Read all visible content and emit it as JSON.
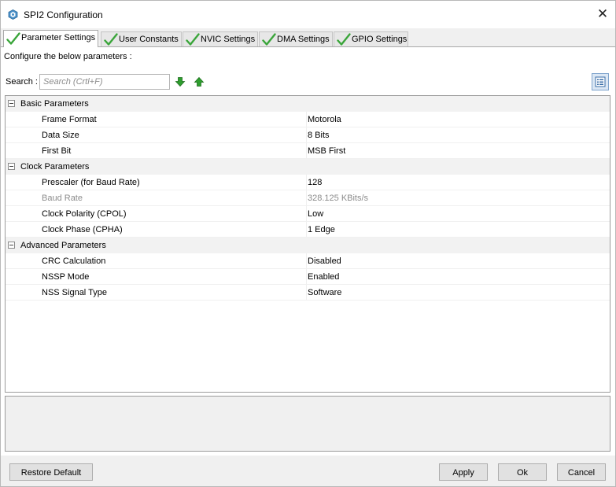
{
  "window": {
    "title": "SPI2 Configuration"
  },
  "tabs": [
    {
      "label": "Parameter Settings",
      "active": true
    },
    {
      "label": "User Constants",
      "active": false
    },
    {
      "label": "NVIC Settings",
      "active": false
    },
    {
      "label": "DMA Settings",
      "active": false
    },
    {
      "label": "GPIO Settings",
      "active": false
    }
  ],
  "instructions": "Configure the below parameters :",
  "search": {
    "label": "Search :",
    "placeholder": "Search (Crtl+F)"
  },
  "groups": [
    {
      "label": "Basic Parameters",
      "params": [
        {
          "name": "Frame Format",
          "value": "Motorola"
        },
        {
          "name": "Data Size",
          "value": "8 Bits"
        },
        {
          "name": "First Bit",
          "value": "MSB First"
        }
      ]
    },
    {
      "label": "Clock Parameters",
      "params": [
        {
          "name": "Prescaler (for Baud Rate)",
          "value": "128"
        },
        {
          "name": "Baud Rate",
          "value": "328.125 KBits/s",
          "readonly": true
        },
        {
          "name": "Clock Polarity (CPOL)",
          "value": "Low"
        },
        {
          "name": "Clock Phase (CPHA)",
          "value": "1 Edge"
        }
      ]
    },
    {
      "label": "Advanced Parameters",
      "params": [
        {
          "name": "CRC Calculation",
          "value": "Disabled"
        },
        {
          "name": "NSSP Mode",
          "value": "Enabled"
        },
        {
          "name": "NSS Signal Type",
          "value": "Software"
        }
      ]
    }
  ],
  "buttons": {
    "restore_default": "Restore Default",
    "apply": "Apply",
    "ok": "Ok",
    "cancel": "Cancel"
  },
  "colors": {
    "check_green": "#3aa53a",
    "arrow_green": "#2e9e2e",
    "group_bg": "#f2f2f2",
    "disabled_text": "#8c8c8c"
  },
  "icons": {
    "title": "stm32-cube-icon",
    "tab": "green-check-icon",
    "search_next": "arrow-down-icon",
    "search_prev": "arrow-up-icon",
    "view_toggle": "list-view-icon",
    "close": "close-icon",
    "group_toggle": "collapse-minus-icon"
  }
}
